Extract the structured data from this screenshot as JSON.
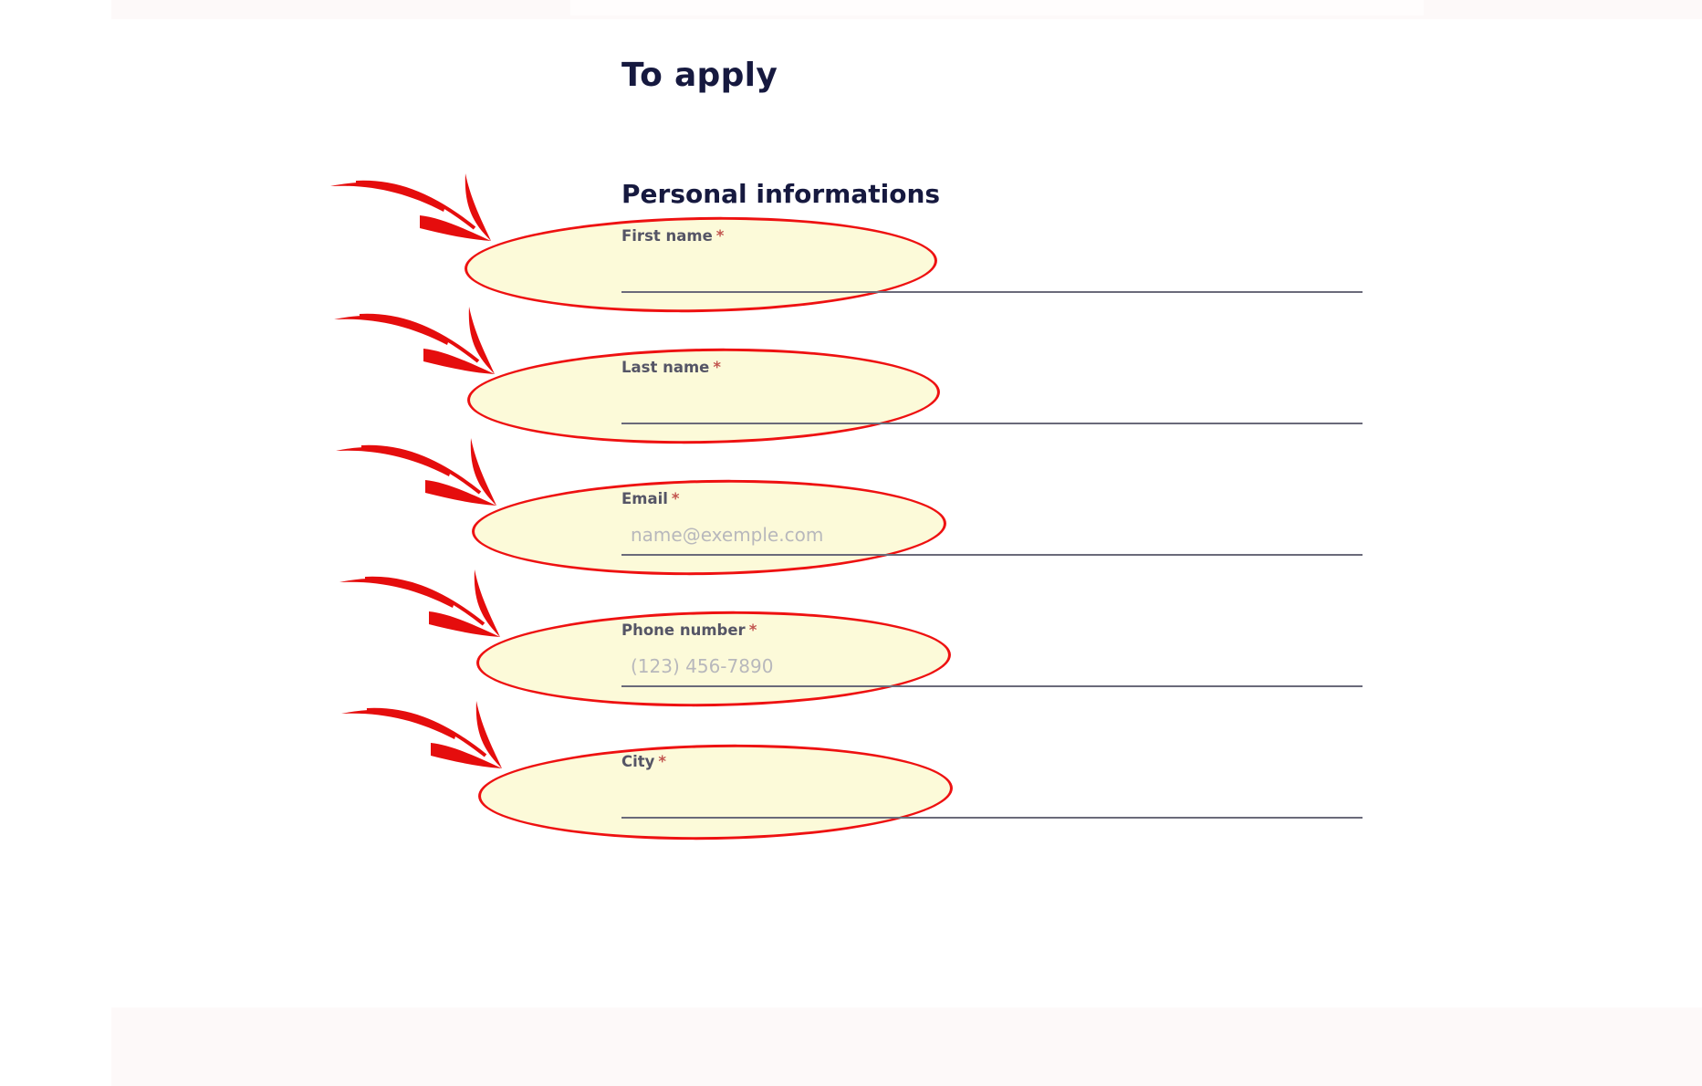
{
  "page": {
    "title": "To apply"
  },
  "section": {
    "title": "Personal informations"
  },
  "form": {
    "required_marker": "*",
    "fields": [
      {
        "label": "First name",
        "placeholder": "",
        "value": ""
      },
      {
        "label": "Last name",
        "placeholder": "",
        "value": ""
      },
      {
        "label": "Email",
        "placeholder": "name@exemple.com",
        "value": ""
      },
      {
        "label": "Phone number",
        "placeholder": "(123) 456-7890",
        "value": ""
      },
      {
        "label": "City",
        "placeholder": "",
        "value": ""
      }
    ]
  },
  "annotations": {
    "highlight_color": "#ee1111",
    "highlight_fill": "#fcfad7",
    "icon": "hand-drawn-arrow-icon"
  },
  "colors": {
    "heading": "#16193f",
    "label": "#555566",
    "required": "#c2554f",
    "underline": "#6a6a7a",
    "placeholder": "#b8b8bc"
  }
}
